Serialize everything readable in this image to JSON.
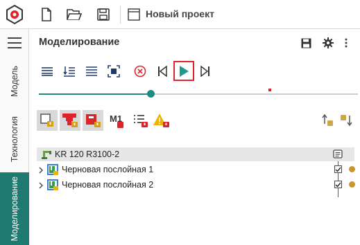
{
  "topbar": {
    "project_title": "Новый проект"
  },
  "sidebar": {
    "tabs": [
      {
        "label": "Модель",
        "active": false
      },
      {
        "label": "Технология",
        "active": false
      },
      {
        "label": "Моделирование",
        "active": true
      }
    ]
  },
  "panel": {
    "title": "Моделирование"
  },
  "filters": {
    "m1_label": "M1"
  },
  "simulation": {
    "progress": 0.35,
    "marker": 0.72
  },
  "tree": {
    "root": {
      "label": "KR 120 R3100-2"
    },
    "children": [
      {
        "label": "Черновая послойная 1",
        "checked": true
      },
      {
        "label": "Черновая послойная 2",
        "checked": true
      }
    ]
  },
  "colors": {
    "accent": "#1f7a72",
    "highlight": "#e0222a",
    "status_dot": "#c8962a"
  }
}
